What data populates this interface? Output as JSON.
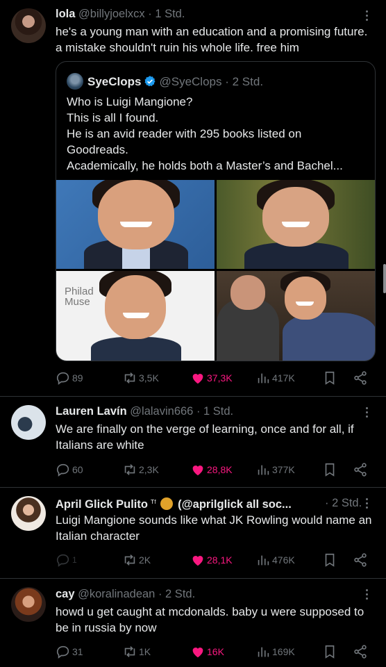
{
  "colors": {
    "accent_like": "#f91880",
    "muted": "#71767b",
    "text": "#e7e9ea",
    "verified": "#1d9bf0"
  },
  "tweets": [
    {
      "name": "lola",
      "handle": "@billyjoelxcx",
      "time": "· 1 Std.",
      "text": "he's a young man with an education and a promising future. a mistake shouldn't ruin his whole life. free him",
      "quote": {
        "name": "SyeClops",
        "handle": "@SyeClops",
        "time": "· 2 Std.",
        "lines": [
          "Who is Luigi Mangione?",
          "This is all I found.",
          "He is an avid reader with 295 books listed on",
          "Goodreads.",
          "Academically, he holds both a Master’s and Bachel..."
        ],
        "photo_sign": "Philad Muse"
      },
      "replies": "89",
      "retweets": "3,5K",
      "likes": "37,3K",
      "views": "417K"
    },
    {
      "name": "Lauren Lavín",
      "handle": "@lalavin666",
      "time": "· 1 Std.",
      "text": "We are finally on the verge of learning, once and for all, if Italians are white",
      "replies": "60",
      "retweets": "2,3K",
      "likes": "28,8K",
      "views": "377K"
    },
    {
      "name": "April Glick Pulito",
      "name_suffix": "ᵀᶠ",
      "handle": "(@aprilglick all soc...",
      "time": "· 2 Std.",
      "text": "Luigi Mangione sounds like what JK Rowling would name an Italian character",
      "replies": "1",
      "retweets": "2K",
      "likes": "28,1K",
      "views": "476K"
    },
    {
      "name": "cay",
      "handle": "@koralinadean",
      "time": "· 2 Std.",
      "text": "howd u get caught at mcdonalds. baby u were supposed to be in russia by now",
      "replies": "31",
      "retweets": "1K",
      "likes": "16K",
      "views": "169K"
    }
  ]
}
